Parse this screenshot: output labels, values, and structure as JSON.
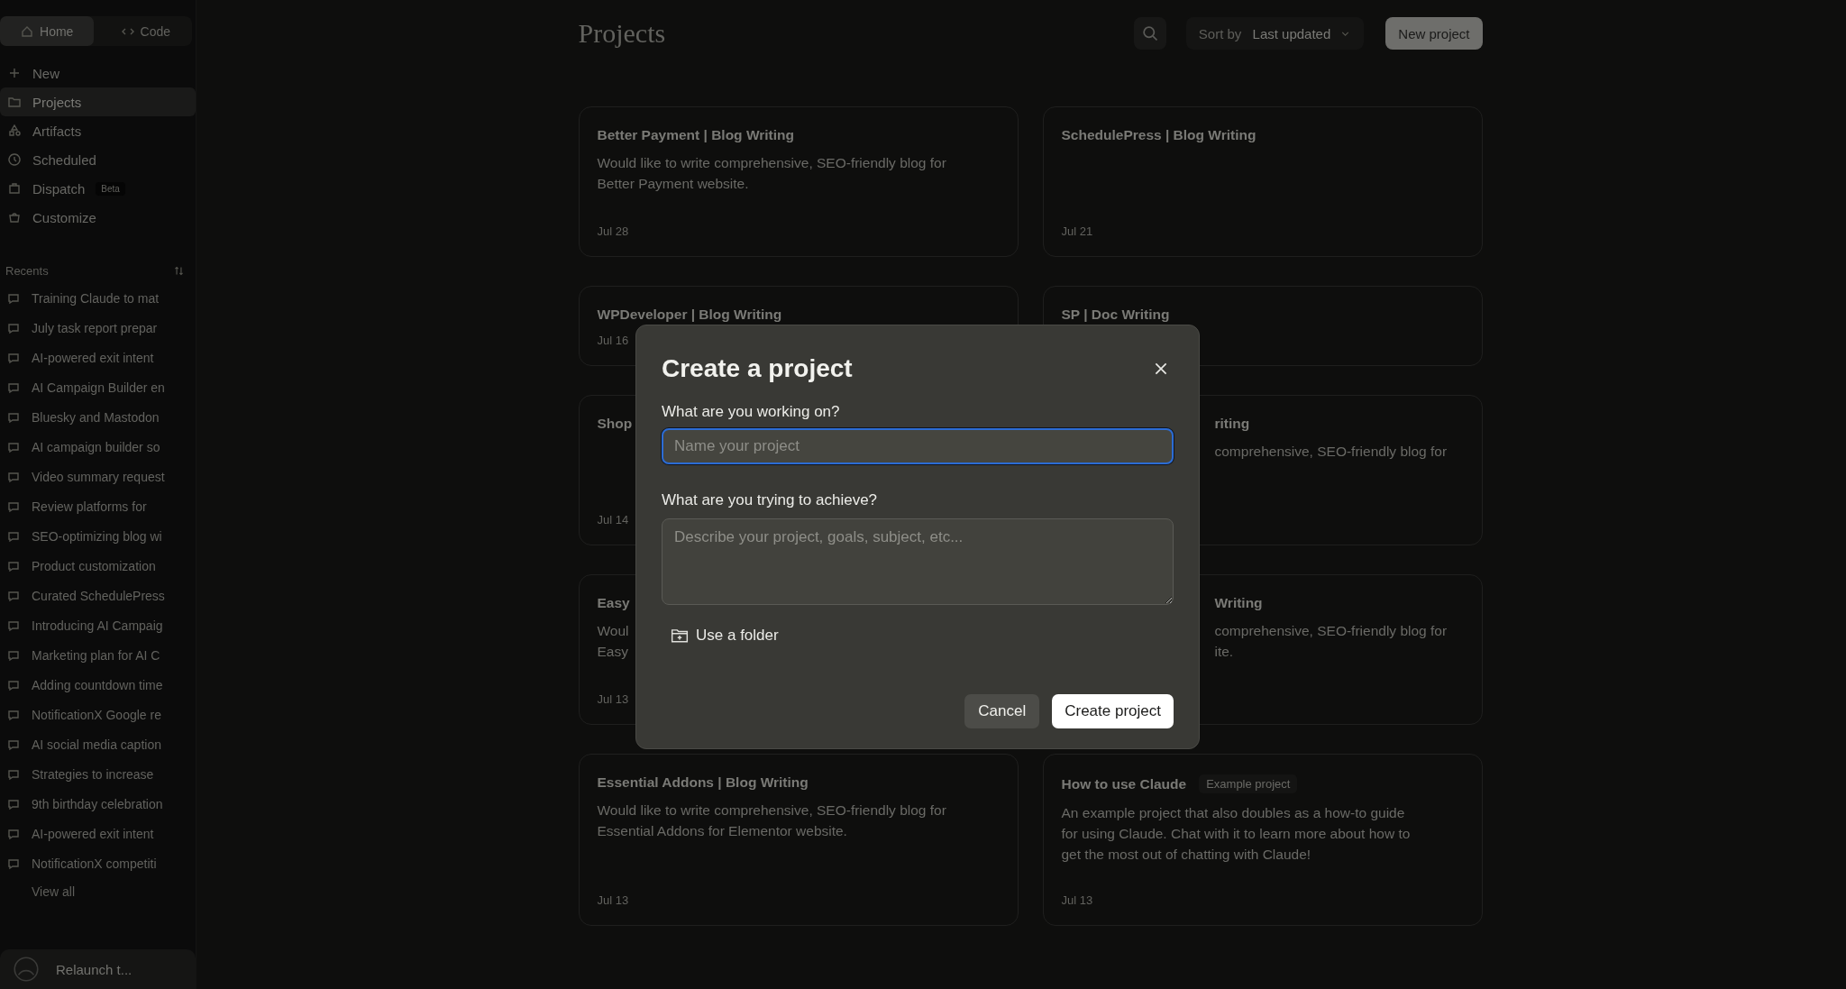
{
  "sidebar": {
    "tabs": [
      {
        "label": "Home",
        "selected": true
      },
      {
        "label": "Code",
        "selected": false
      }
    ],
    "nav": [
      {
        "label": "New",
        "selected": false
      },
      {
        "label": "Projects",
        "selected": true
      },
      {
        "label": "Artifacts",
        "selected": false
      },
      {
        "label": "Scheduled",
        "selected": false
      },
      {
        "label": "Dispatch",
        "selected": false,
        "badge": "Beta"
      },
      {
        "label": "Customize",
        "selected": false
      }
    ],
    "recents_label": "Recents",
    "recents": [
      "Training Claude to mat",
      "July task report prepar",
      "AI-powered exit intent",
      "AI Campaign Builder en",
      "Bluesky and Mastodon",
      "AI campaign builder so",
      "Video summary request",
      "Review platforms for",
      "SEO-optimizing blog wi",
      "Product customization",
      "Curated SchedulePress",
      "Introducing AI Campaig",
      "Marketing plan for AI C",
      "Adding countdown time",
      "NotificationX Google re",
      "AI social media caption",
      "Strategies to increase",
      "9th birthday celebration",
      "AI-powered exit intent",
      "NotificationX competiti"
    ],
    "view_all": "View all",
    "account": {
      "name": "Relaunch t..."
    }
  },
  "header": {
    "title": "Projects",
    "sort_label": "Sort by",
    "sort_value": "Last updated",
    "new_button": "New project"
  },
  "projects": [
    {
      "kind": "full",
      "title": "Better Payment | Blog Writing",
      "description": [
        "Would like to write comprehensive, SEO-friendly blog for",
        "Better Payment website."
      ],
      "date": "Jul 28"
    },
    {
      "kind": "full",
      "title": "SchedulePress | Blog Writing",
      "date": "Jul 21"
    },
    {
      "kind": "full",
      "title": "WPDeveloper | Blog Writing",
      "date": "Jul 16"
    },
    {
      "kind": "full",
      "title": "SP | Doc Writing"
    },
    {
      "kind": "full",
      "title": "Shop",
      "date": "Jul 14"
    },
    {
      "kind": "cut_left",
      "title": "riting",
      "description": [
        "comprehensive, SEO-friendly blog for"
      ]
    },
    {
      "kind": "full",
      "title": "Easy",
      "description": [
        "Woul",
        "Easy"
      ],
      "date": "Jul 13"
    },
    {
      "kind": "cut_left",
      "title": "Writing",
      "description": [
        "comprehensive, SEO-friendly blog for",
        "ite."
      ]
    },
    {
      "kind": "full",
      "title": "Essential Addons | Blog Writing",
      "description": [
        "Would like to write comprehensive, SEO-friendly blog for",
        "Essential Addons for Elementor website."
      ],
      "date": "Jul 13"
    },
    {
      "kind": "full",
      "title": "How to use Claude",
      "tag": "Example project",
      "description": [
        "An example project that also doubles as a how-to guide",
        "for using Claude. Chat with it to learn more about how to",
        "get the most out of chatting with Claude!"
      ],
      "date": "Jul 13"
    }
  ],
  "dialog": {
    "title": "Create a project",
    "name_label": "What are you working on?",
    "name_placeholder": "Name your project",
    "goal_label": "What are you trying to achieve?",
    "goal_placeholder": "Describe your project, goals, subject, etc...",
    "folder_button": "Use a folder",
    "cancel": "Cancel",
    "create": "Create project"
  }
}
